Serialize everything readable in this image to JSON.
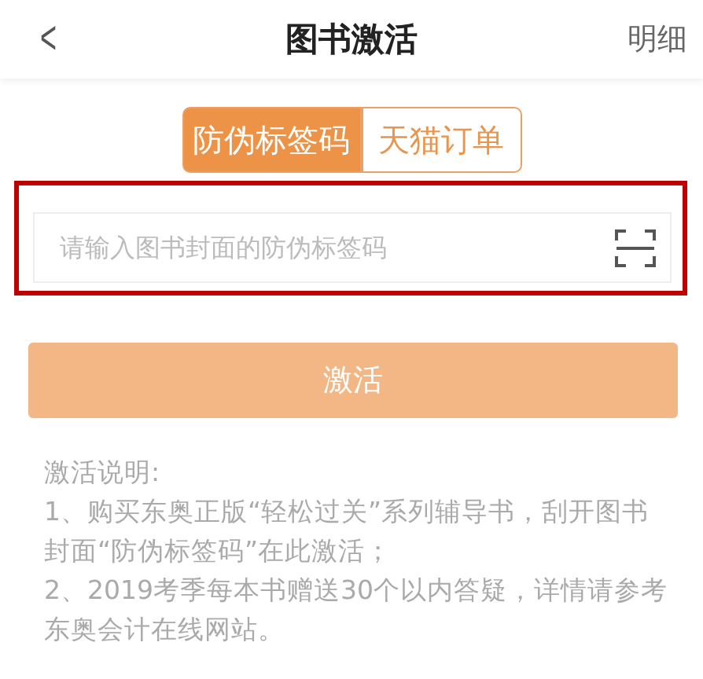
{
  "header": {
    "back": "<",
    "title": "图书激活",
    "action": "明细"
  },
  "tabs": [
    {
      "label": "防伪标签码",
      "selected": true
    },
    {
      "label": "天猫订单",
      "selected": false
    }
  ],
  "code_field": {
    "placeholder": "请输入图书封面的防伪标签码",
    "highlighted": true
  },
  "activate_button": {
    "label": "激活",
    "disabled": true
  },
  "notes": {
    "title": "激活说明:",
    "items": [
      "1、购买东奥正版“轻松过关”系列辅导书，刮开图书封面“防伪标签码”在此激活；",
      "2、2019考季每本书赠送30个以内答疑，详情请参考东奥会计在线网站。"
    ]
  }
}
